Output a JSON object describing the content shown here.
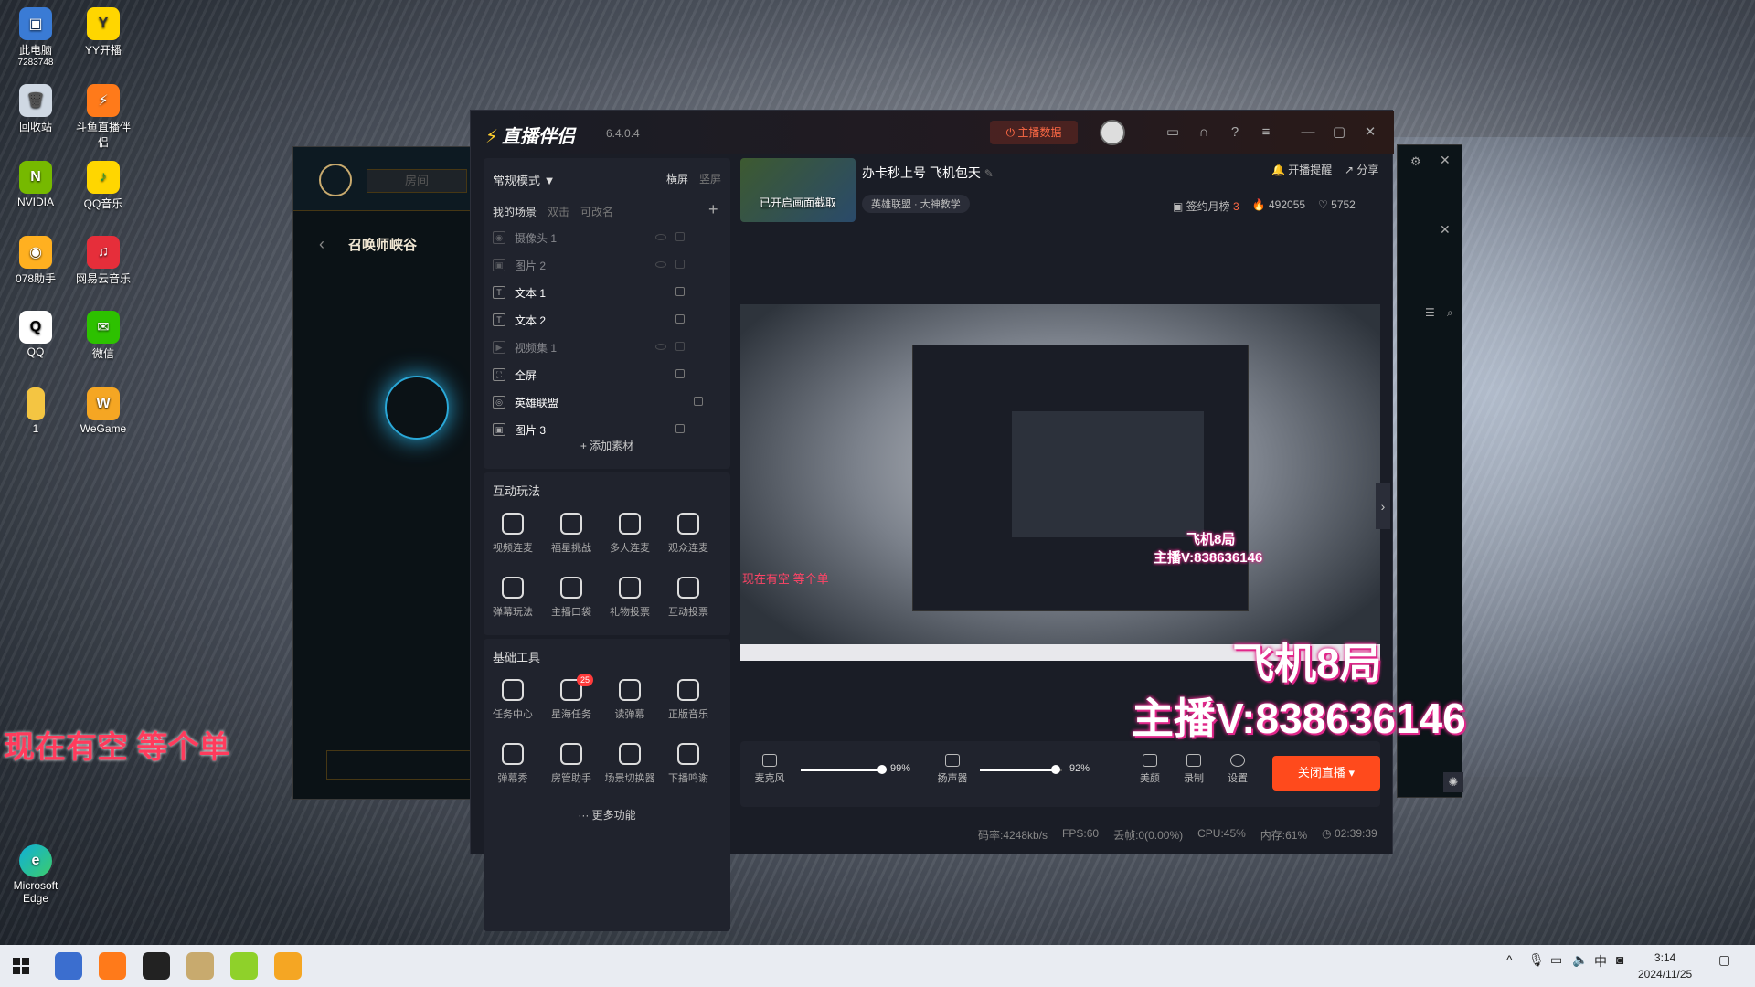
{
  "desktop": {
    "icons": [
      {
        "label": "此电脑",
        "sub": "7283748"
      },
      {
        "label": "YY开播"
      },
      {
        "label": "回收站"
      },
      {
        "label": "斗鱼直播伴侣"
      },
      {
        "label": "NVIDIA"
      },
      {
        "label": "QQ音乐"
      },
      {
        "label": "078助手"
      },
      {
        "label": "网易云音乐"
      },
      {
        "label": "QQ"
      },
      {
        "label": "微信"
      },
      {
        "label": "1"
      },
      {
        "label": "WeGame"
      },
      {
        "label": "Microsoft Edge"
      }
    ],
    "overlay_red_text": "现在有空 等个单"
  },
  "bg_lol": {
    "room_placeholder": "房间",
    "summoner": "召唤师峡谷"
  },
  "app": {
    "brand": "直播伴侣",
    "version": "6.4.0.4",
    "host_data_button": "主播数据",
    "accent_color": "#ff4a1c",
    "left": {
      "mode": "常规模式",
      "landscape": "横屏",
      "portrait": "竖屏",
      "tabs": [
        "我的场景",
        "双击",
        "可改名"
      ],
      "sources": [
        {
          "icon": "camera",
          "name": "摄像头 1",
          "dim": true
        },
        {
          "icon": "image",
          "name": "图片 2",
          "dim": true
        },
        {
          "icon": "text",
          "name": "文本 1",
          "dim": false
        },
        {
          "icon": "text",
          "name": "文本 2",
          "dim": false
        },
        {
          "icon": "video",
          "name": "视频集 1",
          "dim": true
        },
        {
          "icon": "fullscreen",
          "name": "全屏",
          "dim": false
        },
        {
          "icon": "game",
          "name": "英雄联盟",
          "dim": false
        },
        {
          "icon": "image",
          "name": "图片 3",
          "dim": false
        }
      ],
      "add_material": "添加素材",
      "interactive": {
        "title": "互动玩法",
        "items": [
          "视频连麦",
          "福星挑战",
          "多人连麦",
          "观众连麦",
          "弹幕玩法",
          "主播口袋",
          "礼物投票",
          "互动投票"
        ]
      },
      "basic": {
        "title": "基础工具",
        "items": [
          {
            "label": "任务中心"
          },
          {
            "label": "星海任务",
            "badge": "25"
          },
          {
            "label": "读弹幕"
          },
          {
            "label": "正版音乐"
          },
          {
            "label": "弹幕秀"
          },
          {
            "label": "房管助手"
          },
          {
            "label": "场景切换器"
          },
          {
            "label": "下播鸣谢"
          }
        ]
      },
      "more": "更多功能"
    },
    "header": {
      "thumb_label": "已开启画面截取",
      "room_title": "办卡秒上号 飞机包天",
      "category": "英雄联盟 · 大神教学",
      "remind": "开播提醒",
      "share": "分享",
      "sign_month": "签约月榜",
      "sign_rank": "3",
      "hot": "492055",
      "likes": "5752"
    },
    "preview": {
      "red_text": "现在有空 等个单",
      "pink_line1": "飞机8局",
      "pink_line2": "主播V:838636146"
    },
    "overlay": {
      "line1": "飞机8局",
      "line2": "主播V:838636146"
    },
    "controls": {
      "mic_label": "麦克风",
      "mic_pct": "99%",
      "mic_level": 0.99,
      "speaker_label": "扬声器",
      "speaker_pct": "92%",
      "speaker_level": 0.92,
      "beauty": "美颜",
      "record": "录制",
      "settings": "设置",
      "stop": "关闭直播"
    },
    "status": {
      "bitrate": "码率:4248kb/s",
      "fps": "FPS:60",
      "drop": "丢帧:0(0.00%)",
      "cpu": "CPU:45%",
      "mem": "内存:61%",
      "time": "02:39:39"
    }
  },
  "taskbar": {
    "time": "3:14",
    "date": "2024/11/25"
  }
}
